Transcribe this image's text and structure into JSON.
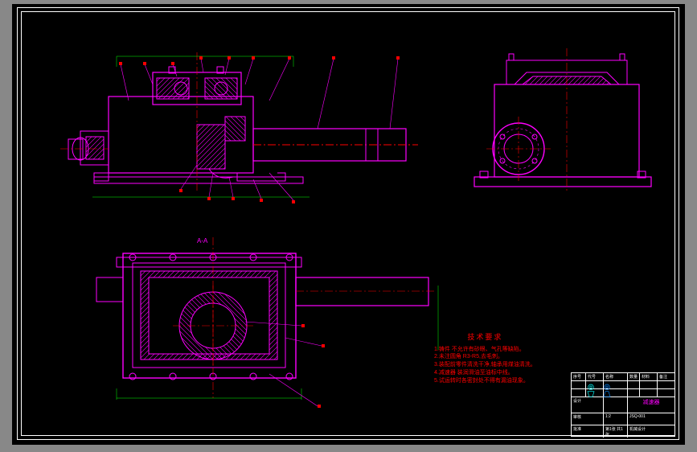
{
  "drawing": {
    "section_label": "A-A",
    "colors": {
      "geometry": "#ff00ff",
      "hatch": "#ff00ff",
      "centerline": "#ff0000",
      "thin": "#00ff00",
      "leader": "#ff00ff",
      "frame": "#ffffff",
      "notes": "#ff0000",
      "stamp1": "#00ffff",
      "stamp2": "#0080ff"
    },
    "views": {
      "front_section": "magenta",
      "right_elevation": "magenta",
      "top_plan": "magenta"
    }
  },
  "technical_requirements": {
    "title": "技术要求",
    "items": [
      "1.铸件 不允许有砂眼、气孔等缺陷。",
      "2.未注圆角 R3-R5,去毛刺。",
      "3.装配前零件清洗干净,轴承用煤油清洗。",
      "4.减速器 装润滑油至油标中线。",
      "5.试运转时各密封处不得有漏油现象。"
    ]
  },
  "title_block": {
    "project": "减速器",
    "drawing_no": "JSQ-001",
    "scale": "1:2",
    "material": "",
    "designer": "设计",
    "checker": "审核",
    "approver": "批准",
    "date": "",
    "sheet": "第1张 共1张",
    "institution": "机械设计",
    "rows": [
      [
        "序号",
        "代号",
        "名称",
        "数量",
        "材料",
        "备注"
      ],
      [
        "",
        "",
        "",
        "",
        "",
        ""
      ],
      [
        "",
        "",
        "",
        "",
        "",
        ""
      ]
    ]
  },
  "stamps": {
    "stamp1_label": "",
    "stamp2_label": ""
  }
}
